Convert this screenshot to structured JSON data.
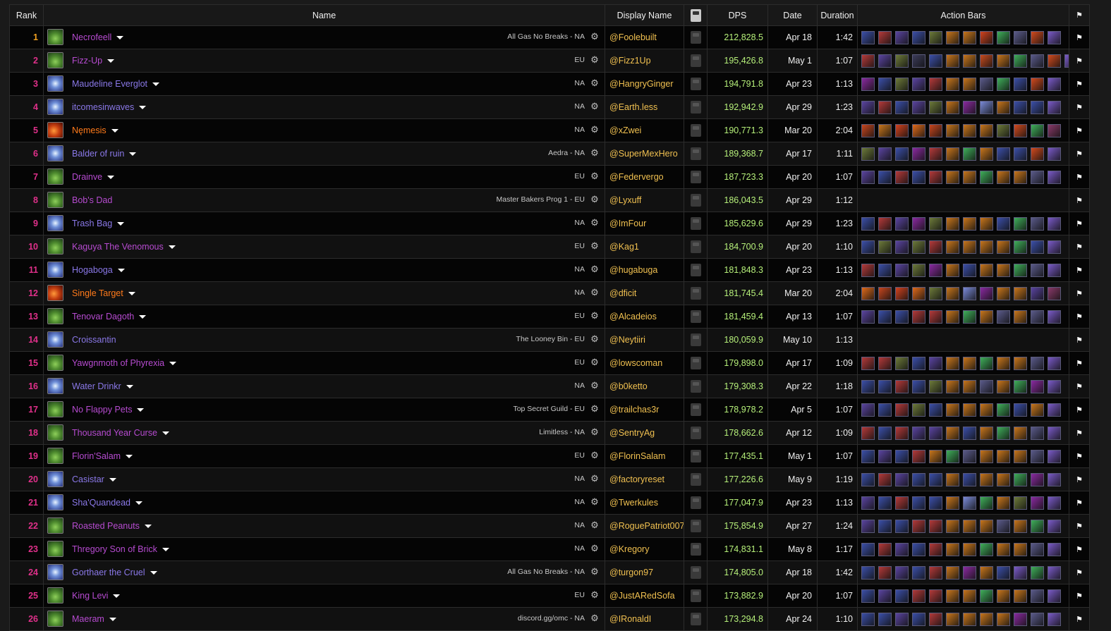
{
  "headers": {
    "rank": "Rank",
    "name": "Name",
    "display": "Display Name",
    "youtube_icon": "youtube-icon",
    "dps": "DPS",
    "date": "Date",
    "duration": "Duration",
    "action_bars": "Action Bars",
    "flag_icon": "flag-icon"
  },
  "colors": {
    "rank_orange": "#f0a020",
    "rank_pink": "#e0308a",
    "warlock_name": "#b64bd0",
    "mage_name": "#8a78e8",
    "fire_name": "#ff7a1a",
    "display_name": "#f0c050",
    "dps_value": "#b6f07a"
  },
  "rows": [
    {
      "rank": "1",
      "spec": "affliction",
      "name": "Necrofeell",
      "guild": "All Gas No Breaks - NA",
      "display": "@Foolebuilt",
      "dps": "212,828.5",
      "date": "Apr 18",
      "duration": "1:42",
      "icons": [
        "#3b4fa8",
        "#b43a3a",
        "#5a44a0",
        "#3b4fa8",
        "#6d7a3a",
        "#c8761c",
        "#c8761c",
        "#d2421e",
        "#3fae5a",
        "#5a5a8a",
        "#d24a1e",
        "#7a5ac8"
      ]
    },
    {
      "rank": "2",
      "spec": "affliction",
      "name": "Fizz-Up",
      "guild": "EU",
      "display": "@Fizz1Up",
      "dps": "195,426.8",
      "date": "May 1",
      "duration": "1:07",
      "icons": [
        "#b43a3a",
        "#5a44a0",
        "#6d7a3a",
        "#3b3b5a",
        "#3b4fa8",
        "#c8761c",
        "#c8761c",
        "#c84a1e",
        "#c8761c",
        "#3fae5a",
        "#5a5a8a",
        "#d24a1e",
        "#7a5ac8"
      ]
    },
    {
      "rank": "3",
      "spec": "frost",
      "name": "Maudeline Everglot",
      "guild": "NA",
      "display": "@HangryGinger",
      "dps": "194,791.8",
      "date": "Apr 23",
      "duration": "1:13",
      "icons": [
        "#8a2aa0",
        "#3b4fa8",
        "#6d7a3a",
        "#5a44a0",
        "#b43a3a",
        "#c8761c",
        "#c8761c",
        "#5a5a8a",
        "#3fae5a",
        "#3b4fa8",
        "#d24a1e",
        "#7a5ac8"
      ]
    },
    {
      "rank": "4",
      "spec": "frost",
      "name": "itcomesinwaves",
      "guild": "NA",
      "display": "@Earth.less",
      "dps": "192,942.9",
      "date": "Apr 29",
      "duration": "1:23",
      "icons": [
        "#5a44a0",
        "#b43a3a",
        "#3b4fa8",
        "#5a44a0",
        "#6d7a3a",
        "#c8761c",
        "#8a2aa0",
        "#7a8ad8",
        "#c8761c",
        "#3b4fa8",
        "#3b4fa8",
        "#7a5ac8"
      ]
    },
    {
      "rank": "5",
      "spec": "fire",
      "name": "Nęmesis",
      "guild": "NA",
      "display": "@xZwei",
      "dps": "190,771.3",
      "date": "Mar 20",
      "duration": "2:04",
      "icons": [
        "#c8461e",
        "#c8761c",
        "#d2421e",
        "#e06a1a",
        "#c8461e",
        "#c8761c",
        "#c8761c",
        "#c8761c",
        "#6d7a3a",
        "#d24a1e",
        "#3fae5a",
        "#8a3a6a"
      ]
    },
    {
      "rank": "6",
      "spec": "frost",
      "name": "Balder of ruin",
      "guild": "Aedra - NA",
      "display": "@SuperMexHero",
      "dps": "189,368.7",
      "date": "Apr 17",
      "duration": "1:11",
      "icons": [
        "#6d7a3a",
        "#5a44a0",
        "#3b4fa8",
        "#8a2aa0",
        "#b43a3a",
        "#c8761c",
        "#3fae5a",
        "#c8761c",
        "#3b4fa8",
        "#3b4fa8",
        "#d24a1e",
        "#7a5ac8"
      ]
    },
    {
      "rank": "7",
      "spec": "affliction",
      "name": "Drainve",
      "guild": "EU",
      "display": "@Federvergo",
      "dps": "187,723.3",
      "date": "Apr 20",
      "duration": "1:07",
      "icons": [
        "#5a44a0",
        "#3b4fa8",
        "#b43a3a",
        "#3b4fa8",
        "#b43a3a",
        "#c8761c",
        "#c8761c",
        "#3fae5a",
        "#c8761c",
        "#c8761c",
        "#5a5a8a",
        "#7a5ac8"
      ]
    },
    {
      "rank": "8",
      "spec": "affliction",
      "name": "Bob's Dad",
      "guild": "Master Bakers Prog 1 - EU",
      "display": "@Lyxuff",
      "dps": "186,043.5",
      "date": "Apr 29",
      "duration": "1:12",
      "icons": []
    },
    {
      "rank": "9",
      "spec": "frost",
      "name": "Trash Bag",
      "guild": "NA",
      "display": "@ImFour",
      "dps": "185,629.6",
      "date": "Apr 29",
      "duration": "1:23",
      "icons": [
        "#3b4fa8",
        "#b43a3a",
        "#5a44a0",
        "#8a2aa0",
        "#6d7a3a",
        "#c8761c",
        "#c8761c",
        "#c8761c",
        "#3b4fa8",
        "#3fae5a",
        "#5a5a8a",
        "#7a5ac8"
      ]
    },
    {
      "rank": "10",
      "spec": "affliction",
      "name": "Kaguya The Venomous",
      "guild": "EU",
      "display": "@Kag1",
      "dps": "184,700.9",
      "date": "Apr 20",
      "duration": "1:10",
      "icons": [
        "#3b4fa8",
        "#6d7a3a",
        "#5a44a0",
        "#6d7a3a",
        "#b43a3a",
        "#c8761c",
        "#c8761c",
        "#c8761c",
        "#c8761c",
        "#3fae5a",
        "#3b4fa8",
        "#7a5ac8"
      ]
    },
    {
      "rank": "11",
      "spec": "frost",
      "name": "Hogaboga",
      "guild": "NA",
      "display": "@hugabuga",
      "dps": "181,848.3",
      "date": "Apr 23",
      "duration": "1:13",
      "icons": [
        "#b43a3a",
        "#3b4fa8",
        "#5a44a0",
        "#6d7a3a",
        "#8a2aa0",
        "#c8761c",
        "#3b4fa8",
        "#c8761c",
        "#c8761c",
        "#3fae5a",
        "#5a5a8a",
        "#7a5ac8"
      ]
    },
    {
      "rank": "12",
      "spec": "fire",
      "name": "Single Target",
      "guild": "NA",
      "display": "@dficit",
      "dps": "181,745.4",
      "date": "Mar 20",
      "duration": "2:04",
      "icons": [
        "#e06a1a",
        "#c8461e",
        "#d2421e",
        "#e06a1a",
        "#6d7a3a",
        "#c8761c",
        "#7a8ad8",
        "#8a2aa0",
        "#c8761c",
        "#c8761c",
        "#5a44a0",
        "#8a3a6a"
      ]
    },
    {
      "rank": "13",
      "spec": "affliction",
      "name": "Tenovar Dagoth",
      "guild": "EU",
      "display": "@Alcadeios",
      "dps": "181,459.4",
      "date": "Apr 13",
      "duration": "1:07",
      "icons": [
        "#5a44a0",
        "#3b4fa8",
        "#3b4fa8",
        "#b43a3a",
        "#b43a3a",
        "#c8761c",
        "#3fae5a",
        "#c8761c",
        "#5a5a8a",
        "#c8761c",
        "#5a5a8a",
        "#7a5ac8"
      ]
    },
    {
      "rank": "14",
      "spec": "frost",
      "name": "Croissantin",
      "guild": "The Looney Bin - EU",
      "display": "@Neytiiri",
      "dps": "180,059.9",
      "date": "May 10",
      "duration": "1:13",
      "icons": []
    },
    {
      "rank": "15",
      "spec": "affliction",
      "name": "Yawgnmoth of Phyrexia",
      "guild": "EU",
      "display": "@lowscoman",
      "dps": "179,898.0",
      "date": "Apr 17",
      "duration": "1:09",
      "icons": [
        "#b43a3a",
        "#b43a3a",
        "#6d7a3a",
        "#3b4fa8",
        "#5a44a0",
        "#c8761c",
        "#c8761c",
        "#3fae5a",
        "#c8761c",
        "#c8761c",
        "#5a5a8a",
        "#7a5ac8"
      ]
    },
    {
      "rank": "16",
      "spec": "frost",
      "name": "Water Drinkr",
      "guild": "NA",
      "display": "@b0ketto",
      "dps": "179,308.3",
      "date": "Apr 22",
      "duration": "1:18",
      "icons": [
        "#3b4fa8",
        "#3b4fa8",
        "#b43a3a",
        "#3b4fa8",
        "#6d7a3a",
        "#c8761c",
        "#c8761c",
        "#5a5a8a",
        "#c8761c",
        "#3fae5a",
        "#8a2aa0",
        "#7a5ac8"
      ]
    },
    {
      "rank": "17",
      "spec": "affliction",
      "name": "No Flappy Pets",
      "guild": "Top Secret Guild - EU",
      "display": "@trailchas3r",
      "dps": "178,978.2",
      "date": "Apr 5",
      "duration": "1:07",
      "icons": [
        "#5a44a0",
        "#3b4fa8",
        "#b43a3a",
        "#6d7a3a",
        "#3b4fa8",
        "#c8761c",
        "#c8761c",
        "#c8761c",
        "#3fae5a",
        "#3b4fa8",
        "#c8761c",
        "#7a5ac8"
      ]
    },
    {
      "rank": "18",
      "spec": "affliction",
      "name": "Thousand Year Curse",
      "guild": "Limitless - NA",
      "display": "@SentryAg",
      "dps": "178,662.6",
      "date": "Apr 12",
      "duration": "1:09",
      "icons": [
        "#b43a3a",
        "#3b4fa8",
        "#b43a3a",
        "#5a44a0",
        "#5a44a0",
        "#c8761c",
        "#3b4fa8",
        "#c8761c",
        "#3fae5a",
        "#c8761c",
        "#5a5a8a",
        "#7a5ac8"
      ]
    },
    {
      "rank": "19",
      "spec": "affliction",
      "name": "Florin'Salam",
      "guild": "EU",
      "display": "@FlorinSalam",
      "dps": "177,435.1",
      "date": "May 1",
      "duration": "1:07",
      "icons": [
        "#3b4fa8",
        "#5a44a0",
        "#3b4fa8",
        "#b43a3a",
        "#c8761c",
        "#3fae5a",
        "#5a5a8a",
        "#c8761c",
        "#c8761c",
        "#c8761c",
        "#5a5a8a",
        "#7a5ac8"
      ]
    },
    {
      "rank": "20",
      "spec": "frost",
      "name": "Casistar",
      "guild": "NA",
      "display": "@factoryreset",
      "dps": "177,226.6",
      "date": "May 9",
      "duration": "1:19",
      "icons": [
        "#3b4fa8",
        "#b43a3a",
        "#5a44a0",
        "#3b4fa8",
        "#3b4fa8",
        "#c8761c",
        "#3b4fa8",
        "#c8761c",
        "#c8761c",
        "#3fae5a",
        "#8a2aa0",
        "#7a5ac8"
      ]
    },
    {
      "rank": "21",
      "spec": "frost",
      "name": "Sha'Quandead",
      "guild": "NA",
      "display": "@Twerkules",
      "dps": "177,047.9",
      "date": "Apr 23",
      "duration": "1:13",
      "icons": [
        "#5a44a0",
        "#3b4fa8",
        "#b43a3a",
        "#3b4fa8",
        "#3b4fa8",
        "#c8761c",
        "#7a8ad8",
        "#3fae5a",
        "#c8761c",
        "#6d7a3a",
        "#8a2aa0",
        "#7a5ac8"
      ]
    },
    {
      "rank": "22",
      "spec": "affliction",
      "name": "Roasted Peanuts",
      "guild": "NA",
      "display": "@RoguePatriot007",
      "dps": "175,854.9",
      "date": "Apr 27",
      "duration": "1:24",
      "icons": [
        "#5a44a0",
        "#3b4fa8",
        "#3b4fa8",
        "#b43a3a",
        "#b43a3a",
        "#c8761c",
        "#c8761c",
        "#c8761c",
        "#5a5a8a",
        "#c8761c",
        "#3fae5a",
        "#7a5ac8"
      ]
    },
    {
      "rank": "23",
      "spec": "affliction",
      "name": "Thregory Son of Brick",
      "guild": "NA",
      "display": "@Kregory",
      "dps": "174,831.1",
      "date": "May 8",
      "duration": "1:17",
      "icons": [
        "#3b4fa8",
        "#b43a3a",
        "#5a44a0",
        "#3b4fa8",
        "#b43a3a",
        "#c8761c",
        "#c8761c",
        "#3fae5a",
        "#c8761c",
        "#c8761c",
        "#5a5a8a",
        "#7a5ac8"
      ]
    },
    {
      "rank": "24",
      "spec": "frost",
      "name": "Gorthaer the Cruel",
      "guild": "All Gas No Breaks - NA",
      "display": "@turgon97",
      "dps": "174,805.0",
      "date": "Apr 18",
      "duration": "1:42",
      "icons": [
        "#3b4fa8",
        "#b43a3a",
        "#5a44a0",
        "#3b4fa8",
        "#b43a3a",
        "#c8761c",
        "#8a2aa0",
        "#c8761c",
        "#3b4fa8",
        "#7a5ac8",
        "#3fae5a",
        "#7a5ac8"
      ]
    },
    {
      "rank": "25",
      "spec": "affliction",
      "name": "King Levi",
      "guild": "EU",
      "display": "@JustARedSofa",
      "dps": "173,882.9",
      "date": "Apr 20",
      "duration": "1:07",
      "icons": [
        "#3b4fa8",
        "#5a44a0",
        "#3b4fa8",
        "#b43a3a",
        "#b43a3a",
        "#c8761c",
        "#c8761c",
        "#3fae5a",
        "#c8761c",
        "#c8761c",
        "#5a5a8a",
        "#7a5ac8"
      ]
    },
    {
      "rank": "26",
      "spec": "affliction",
      "name": "Maeram",
      "guild": "discord.gg/omc - NA",
      "display": "@IRonaldI",
      "dps": "173,294.8",
      "date": "Apr 24",
      "duration": "1:10",
      "icons": [
        "#3b4fa8",
        "#3b4fa8",
        "#5a44a0",
        "#3b4fa8",
        "#b43a3a",
        "#c8761c",
        "#c8761c",
        "#c8761c",
        "#c8761c",
        "#8a2aa0",
        "#5a5a8a",
        "#7a5ac8"
      ]
    }
  ]
}
